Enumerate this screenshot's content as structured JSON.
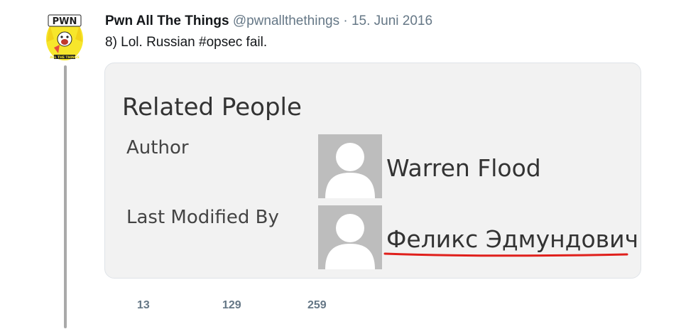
{
  "tweet": {
    "author_name": "Pwn All The Things",
    "handle": "@pwnallthethings",
    "separator": "·",
    "date": "15. Juni 2016",
    "text": "8) Lol. Russian #opsec fail.",
    "avatar": {
      "icon": "pwn-logo-avatar",
      "logo_text": "PWN",
      "logo_subtext": "ALL THE THINGS"
    }
  },
  "card": {
    "heading": "Related People",
    "people": [
      {
        "label": "Author",
        "name": "Warren Flood",
        "avatar_icon": "person-placeholder-icon"
      },
      {
        "label": "Last Modified By",
        "name": "Феликс Эдмундович",
        "avatar_icon": "person-placeholder-icon",
        "underline_color": "#e0201c"
      }
    ]
  },
  "actions": {
    "replies": "13",
    "retweets": "129",
    "likes": "259"
  },
  "colors": {
    "name": "#14171a",
    "muted": "#657786",
    "card_bg": "#f2f2f2",
    "placeholder_bg": "#bdbdbd",
    "logo_yellow": "#f7e62b"
  }
}
